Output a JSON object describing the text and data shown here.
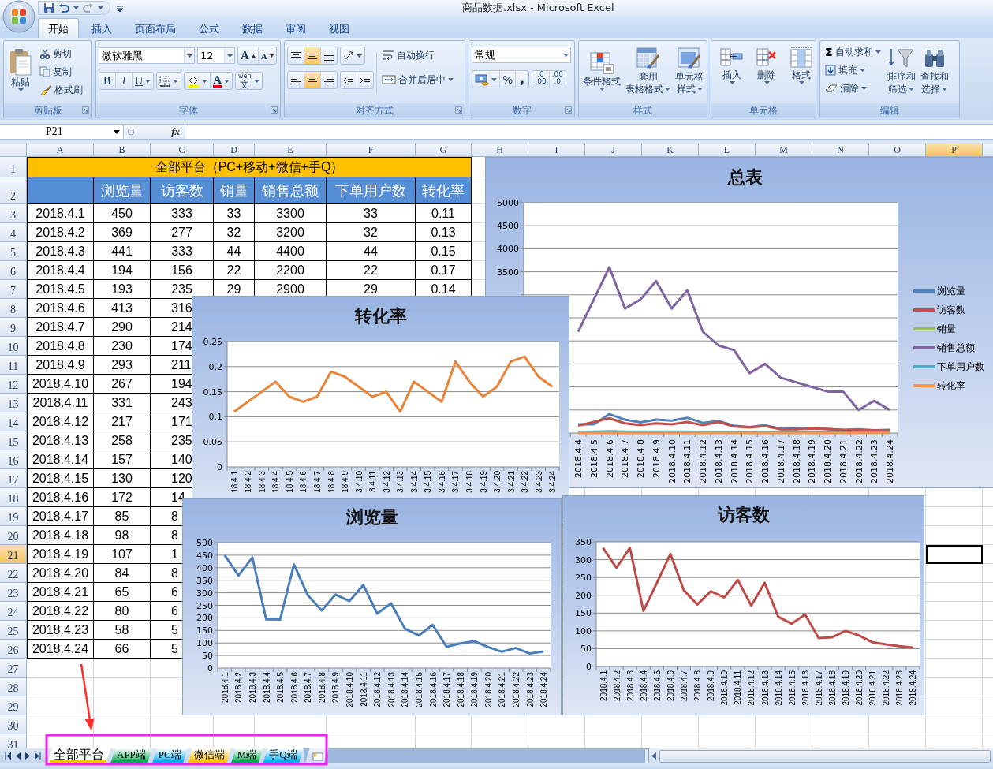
{
  "window": {
    "title": "商品数据.xlsx - Microsoft Excel"
  },
  "ribbon_tabs": [
    {
      "label": "开始",
      "selected": true
    },
    {
      "label": "插入",
      "selected": false
    },
    {
      "label": "页面布局",
      "selected": false
    },
    {
      "label": "公式",
      "selected": false
    },
    {
      "label": "数据",
      "selected": false
    },
    {
      "label": "审阅",
      "selected": false
    },
    {
      "label": "视图",
      "selected": false
    }
  ],
  "ribbon": {
    "clipboard": {
      "label": "剪贴板",
      "paste": "粘贴",
      "tools": [
        "剪切",
        "复制",
        "格式刷"
      ]
    },
    "font": {
      "label": "字体",
      "font_name": "微软雅黑",
      "font_size": "12",
      "grow": "A",
      "shrink": "A",
      "styles": [
        "B",
        "I",
        "U"
      ],
      "font_color": "A",
      "phonetic_top": "wén",
      "phonetic_bottom": "文"
    },
    "alignment": {
      "label": "对齐方式",
      "vertical": [
        {
          "kind": "top",
          "selected": false
        },
        {
          "kind": "middle",
          "selected": true
        },
        {
          "kind": "bottom",
          "selected": false
        }
      ],
      "horizontal": [
        {
          "kind": "left",
          "selected": false
        },
        {
          "kind": "center",
          "selected": true
        },
        {
          "kind": "right",
          "selected": false
        }
      ],
      "wrap": "自动换行",
      "merge": "合并后居中"
    },
    "number": {
      "label": "数字",
      "format": "常规",
      "percent": "%",
      "comma": ",",
      "decimals": [
        {
          "top": ".0",
          "bottom": ".00"
        },
        {
          "top": ".00",
          "bottom": ".0"
        }
      ]
    },
    "styles": {
      "label": "样式",
      "buttons": [
        {
          "kind": "conditional",
          "lines": [
            "条件格式"
          ]
        },
        {
          "kind": "table",
          "lines": [
            "套用",
            "表格格式"
          ]
        },
        {
          "kind": "cell",
          "lines": [
            "单元格",
            "样式"
          ]
        }
      ]
    },
    "cells": {
      "label": "单元格",
      "buttons": [
        {
          "kind": "insert",
          "label": "插入"
        },
        {
          "kind": "delete",
          "label": "删除"
        },
        {
          "kind": "format",
          "label": "格式"
        }
      ]
    },
    "editing": {
      "label": "编辑",
      "tools": [
        {
          "kind": "sum",
          "symbol": "Σ",
          "label": "自动求和"
        },
        {
          "kind": "fill",
          "label": "填充"
        },
        {
          "kind": "clear",
          "label": "清除"
        }
      ],
      "buttons": [
        {
          "kind": "sort",
          "lines": [
            "排序和",
            "筛选"
          ]
        },
        {
          "kind": "find",
          "lines": [
            "查找和",
            "选择"
          ]
        }
      ]
    }
  },
  "formula_bar": {
    "name_box": "P21",
    "function_label": "fx"
  },
  "column_headers": [
    {
      "label": "A",
      "selected": false
    },
    {
      "label": "B",
      "selected": false
    },
    {
      "label": "C",
      "selected": false
    },
    {
      "label": "D",
      "selected": false
    },
    {
      "label": "E",
      "selected": false
    },
    {
      "label": "F",
      "selected": false
    },
    {
      "label": "G",
      "selected": false
    },
    {
      "label": "H",
      "selected": false
    },
    {
      "label": "I",
      "selected": false
    },
    {
      "label": "J",
      "selected": false
    },
    {
      "label": "K",
      "selected": false
    },
    {
      "label": "L",
      "selected": false
    },
    {
      "label": "M",
      "selected": false
    },
    {
      "label": "N",
      "selected": false
    },
    {
      "label": "O",
      "selected": false
    },
    {
      "label": "P",
      "selected": true
    }
  ],
  "row_headers": [
    {
      "label": "1",
      "selected": false
    },
    {
      "label": "2",
      "selected": false
    },
    {
      "label": "3",
      "selected": false
    },
    {
      "label": "4",
      "selected": false
    },
    {
      "label": "5",
      "selected": false
    },
    {
      "label": "6",
      "selected": false
    },
    {
      "label": "7",
      "selected": false
    },
    {
      "label": "8",
      "selected": false
    },
    {
      "label": "9",
      "selected": false
    },
    {
      "label": "10",
      "selected": false
    },
    {
      "label": "11",
      "selected": false
    },
    {
      "label": "12",
      "selected": false
    },
    {
      "label": "13",
      "selected": false
    },
    {
      "label": "14",
      "selected": false
    },
    {
      "label": "15",
      "selected": false
    },
    {
      "label": "16",
      "selected": false
    },
    {
      "label": "17",
      "selected": false
    },
    {
      "label": "18",
      "selected": false
    },
    {
      "label": "19",
      "selected": false
    },
    {
      "label": "20",
      "selected": false
    },
    {
      "label": "21",
      "selected": true
    },
    {
      "label": "22",
      "selected": false
    },
    {
      "label": "23",
      "selected": false
    },
    {
      "label": "24",
      "selected": false
    },
    {
      "label": "25",
      "selected": false
    },
    {
      "label": "26",
      "selected": false
    },
    {
      "label": "27",
      "selected": false
    },
    {
      "label": "28",
      "selected": false
    },
    {
      "label": "29",
      "selected": false
    },
    {
      "label": "30",
      "selected": false
    },
    {
      "label": "31",
      "selected": false
    }
  ],
  "table": {
    "title": "全部平台（PC+移动+微信+手Q）",
    "headers": [
      "浏览量",
      "访客数",
      "销量",
      "销售总额",
      "下单用户数",
      "转化率"
    ],
    "rows": [
      [
        "2018.4.1",
        "450",
        "333",
        "33",
        "3300",
        "33",
        "0.11"
      ],
      [
        "2018.4.2",
        "369",
        "277",
        "32",
        "3200",
        "32",
        "0.13"
      ],
      [
        "2018.4.3",
        "441",
        "333",
        "44",
        "4400",
        "44",
        "0.15"
      ],
      [
        "2018.4.4",
        "194",
        "156",
        "22",
        "2200",
        "22",
        "0.17"
      ],
      [
        "2018.4.5",
        "193",
        "235",
        "29",
        "2900",
        "29",
        "0.14"
      ],
      [
        "2018.4.6",
        "413",
        "316"
      ],
      [
        "2018.4.7",
        "290",
        "214"
      ],
      [
        "2018.4.8",
        "230",
        "174"
      ],
      [
        "2018.4.9",
        "293",
        "211"
      ],
      [
        "2018.4.10",
        "267",
        "194"
      ],
      [
        "2018.4.11",
        "331",
        "243"
      ],
      [
        "2018.4.12",
        "217",
        "171"
      ],
      [
        "2018.4.13",
        "258",
        "235"
      ],
      [
        "2018.4.14",
        "157",
        "140"
      ],
      [
        "2018.4.15",
        "130",
        "120"
      ],
      [
        "2018.4.16",
        "172",
        "14"
      ],
      [
        "2018.4.17",
        "85",
        "8"
      ],
      [
        "2018.4.18",
        "98",
        "8"
      ],
      [
        "2018.4.19",
        "107",
        "1"
      ],
      [
        "2018.4.20",
        "84",
        "8"
      ],
      [
        "2018.4.21",
        "65",
        "6"
      ],
      [
        "2018.4.22",
        "80",
        "6"
      ],
      [
        "2018.4.23",
        "58",
        "5"
      ],
      [
        "2018.4.24",
        "66",
        "5"
      ]
    ]
  },
  "charts": [
    {
      "chart_data": {
        "type": "line",
        "title": "总表",
        "legend": "right",
        "grid": true,
        "categories": [
          null,
          null,
          null,
          "2018.4.4",
          "2018.4.5",
          "2018.4.6",
          "2018.4.7",
          "2018.4.8",
          "2018.4.9",
          "2018.4.10",
          "2018.4.11",
          "2018.4.12",
          "2018.4.13",
          "2018.4.14",
          "2018.4.15",
          "2018.4.16",
          "2018.4.17",
          "2018.4.18",
          "2018.4.19",
          "2018.4.20",
          "2018.4.21",
          "2018.4.22",
          "2018.4.23",
          "2018.4.24"
        ],
        "ylim": [
          0,
          5000
        ],
        "yticks": [
          {
            "value": 3500,
            "label": "3500"
          },
          {
            "value": 4000,
            "label": "4000"
          },
          {
            "value": 4500,
            "label": "4500"
          },
          {
            "value": 5000,
            "label": "5000"
          }
        ],
        "series": [
          {
            "name": "浏览量",
            "color": "#4f81bd",
            "values": [
              null,
              null,
              null,
              190,
              190,
              410,
              290,
              230,
              290,
              270,
              330,
              220,
              260,
              160,
              130,
              170,
              90,
              100,
              110,
              80,
              70,
              80,
              60,
              70
            ]
          },
          {
            "name": "访客数",
            "color": "#c0504d",
            "values": [
              null,
              null,
              null,
              160,
              240,
              320,
              210,
              170,
              210,
              190,
              240,
              170,
              240,
              140,
              120,
              150,
              80,
              80,
              100,
              90,
              70,
              60,
              60,
              50
            ]
          },
          {
            "name": "销量",
            "color": "#9bbb59",
            "values": [
              null,
              null,
              null,
              null,
              null,
              null,
              null,
              null,
              null,
              null,
              null,
              null,
              null,
              null,
              null,
              null,
              null,
              null,
              null,
              null,
              null,
              null,
              null,
              null
            ]
          },
          {
            "name": "销售总额",
            "color": "#8064a2",
            "values": [
              null,
              null,
              null,
              2200,
              2900,
              3600,
              2700,
              2900,
              3300,
              2700,
              3100,
              2200,
              1900,
              1800,
              1300,
              1500,
              1200,
              1100,
              1000,
              900,
              900,
              500,
              700,
              500
            ]
          },
          {
            "name": "下单用户数",
            "color": "#4bacc6",
            "values": [
              null,
              null,
              null,
              20,
              30,
              40,
              30,
              30,
              30,
              30,
              30,
              20,
              20,
              20,
              10,
              20,
              10,
              10,
              10,
              10,
              10,
              10,
              10,
              10
            ]
          },
          {
            "name": "转化率",
            "color": "#f79646",
            "values": [
              null,
              null,
              null,
              0,
              0,
              0,
              0,
              0,
              0,
              0,
              0,
              0,
              0,
              0,
              0,
              0,
              0,
              0,
              0,
              0,
              0,
              0,
              0,
              0
            ]
          }
        ]
      }
    },
    {
      "chart_data": {
        "type": "line",
        "title": "转化率",
        "grid": true,
        "categories": [
          "18.4.1",
          "18.4.2",
          "18.4.3",
          "18.4.4",
          "18.4.5",
          "18.4.6",
          "18.4.7",
          "18.4.8",
          "18.4.9",
          "3.4.10",
          "3.4.11",
          "3.4.12",
          "3.4.13",
          "3.4.14",
          "3.4.15",
          "3.4.16",
          "3.4.17",
          "3.4.18",
          "3.4.19",
          "3.4.20",
          "3.4.21",
          "3.4.22",
          "3.4.23",
          "3.4.24"
        ],
        "ylim": [
          0,
          0.25
        ],
        "yticks": [
          {
            "value": 0,
            "label": "0"
          },
          {
            "value": 0.05,
            "label": "0.05"
          },
          {
            "value": 0.1,
            "label": "0.1"
          },
          {
            "value": 0.15,
            "label": "0.15"
          },
          {
            "value": 0.2,
            "label": "0.2"
          },
          {
            "value": 0.25,
            "label": "0.25"
          }
        ],
        "series": [
          {
            "color": "#e8843a",
            "values": [
              0.11,
              0.13,
              0.15,
              0.17,
              0.14,
              0.13,
              0.14,
              0.19,
              0.18,
              0.16,
              0.14,
              0.15,
              0.11,
              0.17,
              0.15,
              0.13,
              0.21,
              0.17,
              0.14,
              0.16,
              0.21,
              0.22,
              0.18,
              0.16
            ]
          }
        ]
      }
    },
    {
      "chart_data": {
        "type": "line",
        "title": "浏览量",
        "grid": true,
        "categories": [
          "2018.4.1",
          "2018.4.2",
          "2018.4.3",
          "2018.4.4",
          "2018.4.5",
          "2018.4.6",
          "2018.4.7",
          "2018.4.8",
          "2018.4.9",
          "2018.4.10",
          "2018.4.11",
          "2018.4.12",
          "2018.4.13",
          "2018.4.14",
          "2018.4.15",
          "2018.4.16",
          "2018.4.17",
          "2018.4.18",
          "2018.4.19",
          "2018.4.20",
          "2018.4.21",
          "2018.4.22",
          "2018.4.23",
          "2018.4.24"
        ],
        "ylim": [
          0,
          500
        ],
        "yticks": [
          {
            "value": 0,
            "label": "0"
          },
          {
            "value": 50,
            "label": "50"
          },
          {
            "value": 100,
            "label": "100"
          },
          {
            "value": 150,
            "label": "150"
          },
          {
            "value": 200,
            "label": "200"
          },
          {
            "value": 250,
            "label": "250"
          },
          {
            "value": 300,
            "label": "300"
          },
          {
            "value": 350,
            "label": "350"
          },
          {
            "value": 400,
            "label": "400"
          },
          {
            "value": 450,
            "label": "450"
          },
          {
            "value": 500,
            "label": "500"
          }
        ],
        "series": [
          {
            "color": "#4a7ebb",
            "values": [
              450,
              369,
              441,
              194,
              193,
              413,
              290,
              230,
              293,
              267,
              331,
              217,
              258,
              157,
              130,
              172,
              85,
              98,
              107,
              84,
              65,
              80,
              58,
              66
            ]
          }
        ]
      }
    },
    {
      "chart_data": {
        "type": "line",
        "title": "访客数",
        "grid": true,
        "categories": [
          "2018.4.1",
          "2018.4.2",
          "2018.4.3",
          "2018.4.4",
          "2018.4.5",
          "2018.4.6",
          "2018.4.7",
          "2018.4.8",
          "2018.4.9",
          "2018.4.10",
          "2018.4.11",
          "2018.4.12",
          "2018.4.13",
          "2018.4.14",
          "2018.4.15",
          "2018.4.16",
          "2018.4.17",
          "2018.4.18",
          "2018.4.19",
          "2018.4.20",
          "2018.4.21",
          "2018.4.22",
          "2018.4.23",
          "2018.4.24"
        ],
        "ylim": [
          0,
          350
        ],
        "yticks": [
          {
            "value": 0,
            "label": "0"
          },
          {
            "value": 50,
            "label": "50"
          },
          {
            "value": 100,
            "label": "100"
          },
          {
            "value": 150,
            "label": "150"
          },
          {
            "value": 200,
            "label": "200"
          },
          {
            "value": 250,
            "label": "250"
          },
          {
            "value": 300,
            "label": "300"
          },
          {
            "value": 350,
            "label": "350"
          }
        ],
        "series": [
          {
            "color": "#be4b48",
            "values": [
              333,
              277,
              333,
              156,
              235,
              316,
              214,
              174,
              211,
              194,
              243,
              171,
              235,
              140,
              120,
              146,
              80,
              82,
              100,
              87,
              68,
              62,
              57,
              53
            ]
          }
        ]
      }
    }
  ],
  "sheet_tabs": [
    {
      "label": "全部平台",
      "selected": true,
      "color": "#ffc000"
    },
    {
      "label": "APP端",
      "selected": false,
      "color": "#00b050"
    },
    {
      "label": "PC端",
      "selected": false,
      "color": "#00b0f0"
    },
    {
      "label": "微信端",
      "selected": false,
      "color": "#ffc000"
    },
    {
      "label": "M端",
      "selected": false,
      "color": "#00b050"
    },
    {
      "label": "手Q端",
      "selected": false,
      "color": "#00b0f0"
    }
  ]
}
